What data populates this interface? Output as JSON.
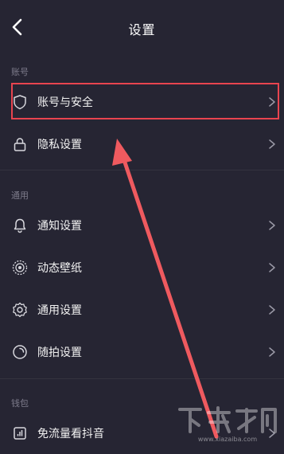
{
  "header": {
    "title": "设置"
  },
  "sections": {
    "account": "账号",
    "general": "通用",
    "wallet": "钱包"
  },
  "items": {
    "account_security": "账号与安全",
    "privacy": "隐私设置",
    "notifications": "通知设置",
    "live_wallpaper": "动态壁纸",
    "general_settings": "通用设置",
    "snap_settings": "随拍设置",
    "data_free": "免流量看抖音"
  },
  "watermark": "www.xiazaiba.com",
  "colors": {
    "background": "#262533",
    "highlight": "#e8444f",
    "annotation_arrow": "#ef5a5f",
    "muted_text": "#7d7b8b"
  }
}
